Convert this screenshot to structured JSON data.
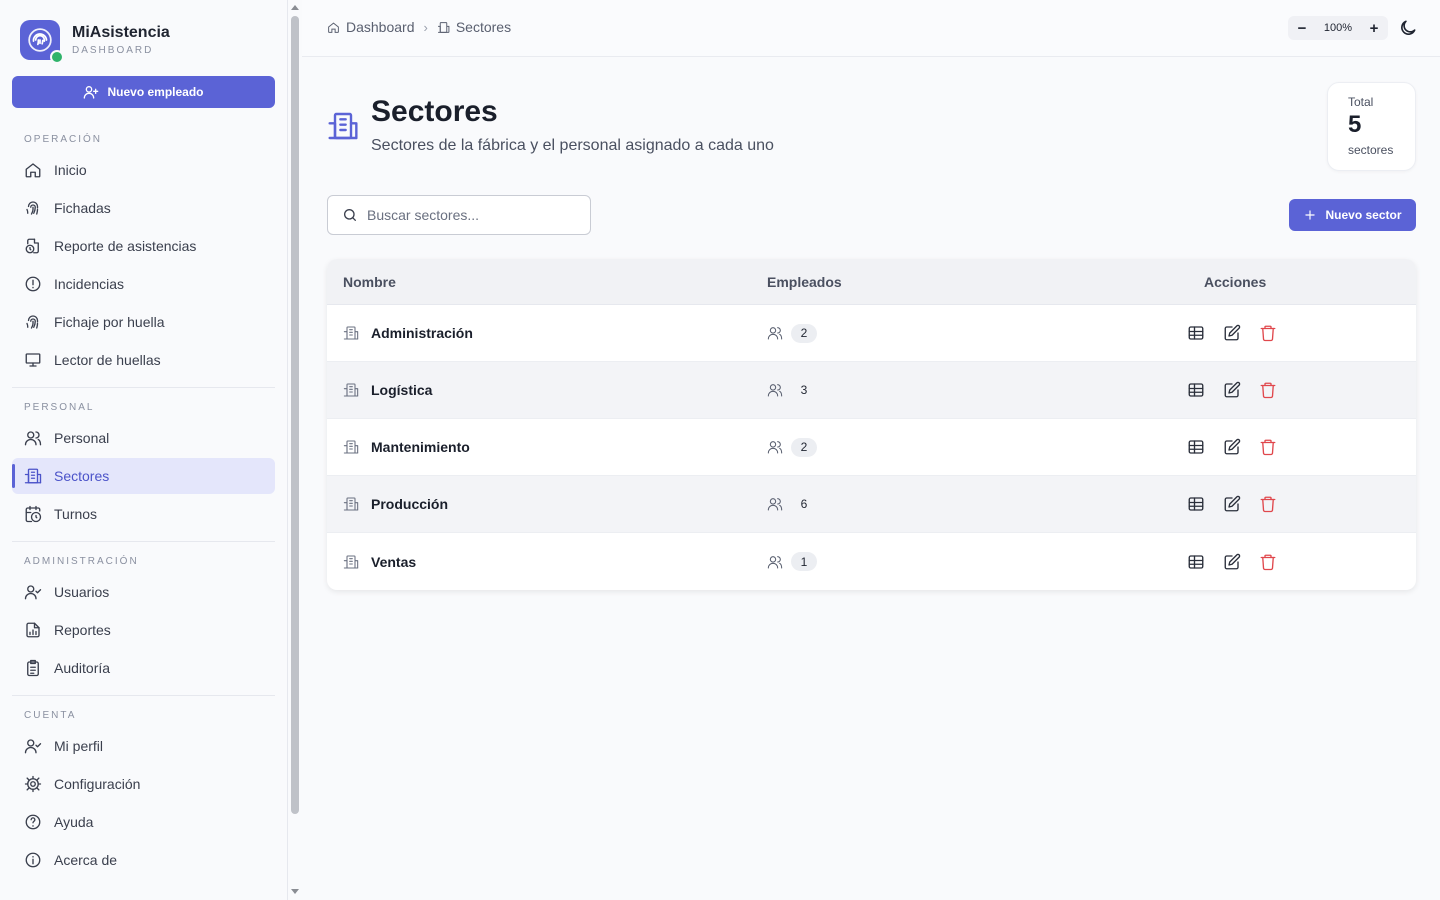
{
  "brand": {
    "title": "MiAsistencia",
    "subtitle": "DASHBOARD"
  },
  "sidebar": {
    "new_employee_label": "Nuevo empleado",
    "sections": [
      {
        "title": "OPERACIÓN",
        "items": [
          "Inicio",
          "Fichadas",
          "Reporte de asistencias",
          "Incidencias",
          "Fichaje por huella",
          "Lector de huellas"
        ]
      },
      {
        "title": "PERSONAL",
        "items": [
          "Personal",
          "Sectores",
          "Turnos"
        ]
      },
      {
        "title": "ADMINISTRACIÓN",
        "items": [
          "Usuarios",
          "Reportes",
          "Auditoría"
        ]
      },
      {
        "title": "CUENTA",
        "items": [
          "Mi perfil",
          "Configuración",
          "Ayuda",
          "Acerca de"
        ]
      }
    ],
    "active_item": "Sectores"
  },
  "topbar": {
    "breadcrumb": [
      "Dashboard",
      "Sectores"
    ],
    "zoom": "100%",
    "zoom_minus": "−",
    "zoom_plus": "+"
  },
  "header": {
    "title": "Sectores",
    "subtitle": "Sectores de la fábrica y el personal asignado a cada uno",
    "total_label": "Total",
    "total_value": "5",
    "total_unit": "sectores"
  },
  "search": {
    "placeholder": "Buscar sectores..."
  },
  "new_sector_label": "Nuevo sector",
  "table": {
    "columns": [
      "Nombre",
      "Empleados",
      "Acciones"
    ],
    "rows": [
      {
        "name": "Administración",
        "employees": "2"
      },
      {
        "name": "Logística",
        "employees": "3"
      },
      {
        "name": "Mantenimiento",
        "employees": "2"
      },
      {
        "name": "Producción",
        "employees": "6"
      },
      {
        "name": "Ventas",
        "employees": "1"
      }
    ]
  },
  "colors": {
    "accent": "#5b63d6",
    "danger": "#e0474c",
    "online": "#2fb36a"
  }
}
